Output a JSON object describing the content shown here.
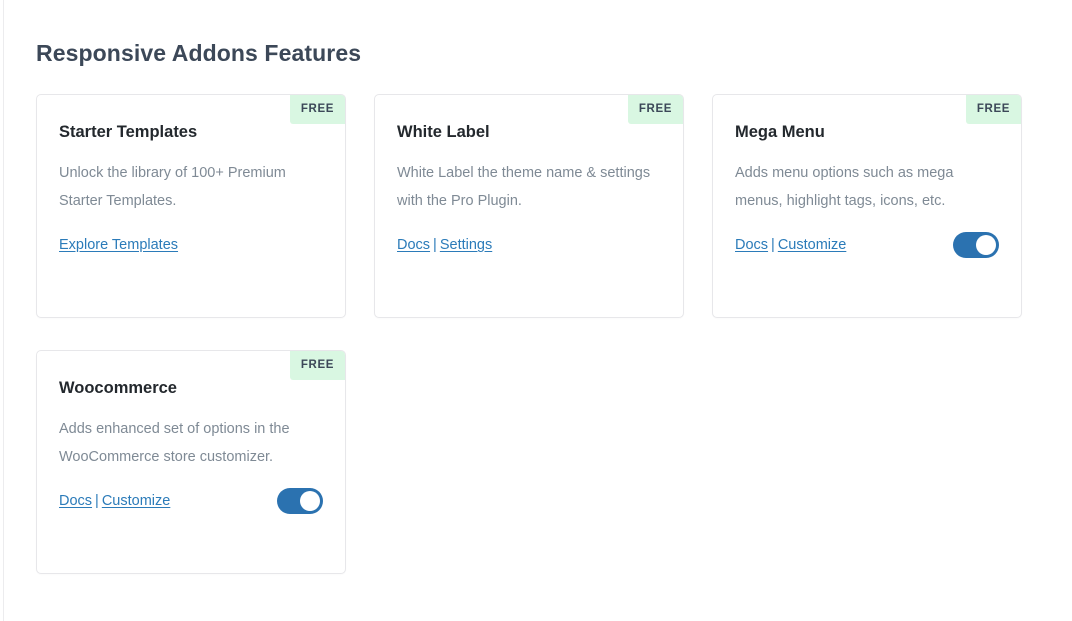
{
  "header": {
    "title": "Responsive Addons Features"
  },
  "colors": {
    "badge_background": "#d9f7e2",
    "badge_text": "#3c4858",
    "link": "#2b7bb9",
    "toggle_on": "#2b72b0",
    "title": "#3c4858",
    "card_title": "#23282d",
    "card_text": "#7f8a95",
    "card_border": "#e7e7ea"
  },
  "cards": [
    {
      "badge": "FREE",
      "title": "Starter Templates",
      "description": "Unlock the library of 100+ Premium Starter Templates.",
      "links": [
        {
          "label": "Explore Templates",
          "name": "explore-templates-link"
        }
      ],
      "separator": "|",
      "toggle": {
        "present": false,
        "state": "off"
      }
    },
    {
      "badge": "FREE",
      "title": "White Label",
      "description": "White Label the theme name & settings with the Pro Plugin.",
      "links": [
        {
          "label": "Docs",
          "name": "docs-link"
        },
        {
          "label": "Settings",
          "name": "settings-link"
        }
      ],
      "separator": "|",
      "toggle": {
        "present": false,
        "state": "off"
      }
    },
    {
      "badge": "FREE",
      "title": "Mega Menu",
      "description": "Adds menu options such as mega menus, highlight tags, icons, etc.",
      "links": [
        {
          "label": "Docs",
          "name": "docs-link"
        },
        {
          "label": "Customize",
          "name": "customize-link"
        }
      ],
      "separator": "|",
      "toggle": {
        "present": true,
        "state": "on"
      }
    },
    {
      "badge": "FREE",
      "title": "Woocommerce",
      "description": "Adds enhanced set of options in the WooCommerce store customizer.",
      "links": [
        {
          "label": "Docs",
          "name": "docs-link"
        },
        {
          "label": "Customize",
          "name": "customize-link"
        }
      ],
      "separator": "|",
      "toggle": {
        "present": true,
        "state": "on"
      }
    }
  ]
}
